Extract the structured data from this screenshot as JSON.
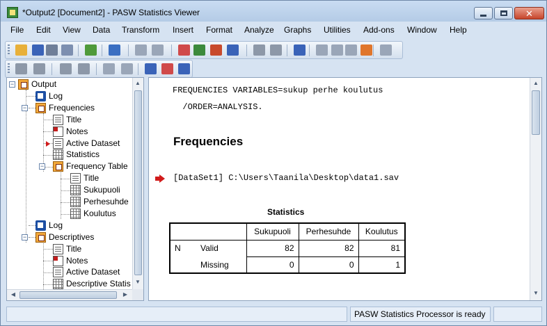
{
  "window": {
    "title": "*Output2 [Document2] - PASW Statistics Viewer",
    "min_glyph": "",
    "close_glyph": "✕"
  },
  "menu": [
    {
      "label": "File"
    },
    {
      "label": "Edit"
    },
    {
      "label": "View"
    },
    {
      "label": "Data"
    },
    {
      "label": "Transform"
    },
    {
      "label": "Insert"
    },
    {
      "label": "Format"
    },
    {
      "label": "Analyze"
    },
    {
      "label": "Graphs"
    },
    {
      "label": "Utilities"
    },
    {
      "label": "Add-ons"
    },
    {
      "label": "Window"
    },
    {
      "label": "Help"
    }
  ],
  "toolbar_icons": [
    {
      "name": "open-icon",
      "color": "#e8b03a"
    },
    {
      "name": "save-icon",
      "color": "#3a63b8"
    },
    {
      "name": "print-icon",
      "color": "#6f7f99"
    },
    {
      "name": "print-preview-icon",
      "color": "#7d8fb0"
    },
    {
      "name": "export-icon",
      "color": "#4f9a3a"
    },
    {
      "name": "recall-dialog-icon",
      "color": "#3b6fc2"
    },
    {
      "name": "undo-icon",
      "color": "#9aa6b8"
    },
    {
      "name": "redo-icon",
      "color": "#9aa6b8"
    },
    {
      "name": "goto-data-icon",
      "color": "#d04a4a"
    },
    {
      "name": "goto-case-icon",
      "color": "#3c8a3c"
    },
    {
      "name": "goto-variable-icon",
      "color": "#c84a2c"
    },
    {
      "name": "variables-icon",
      "color": "#3a63b8"
    },
    {
      "name": "use-sets-icon",
      "color": "#8d98a8"
    },
    {
      "name": "show-all-icon",
      "color": "#8d98a8"
    },
    {
      "name": "spell-check-icon",
      "color": "#3a63b8"
    },
    {
      "name": "promote-icon",
      "color": "#9aa6b8"
    },
    {
      "name": "demote-icon",
      "color": "#9aa6b8"
    },
    {
      "name": "designate-window-icon",
      "color": "#9aa6b8"
    },
    {
      "name": "run-script-icon",
      "color": "#e0762c"
    },
    {
      "name": "hide-icon",
      "color": "#9aa6b8"
    }
  ],
  "toolbar2_icons": [
    {
      "name": "back-arrow-icon",
      "color": "#8d98a8"
    },
    {
      "name": "forward-arrow-icon",
      "color": "#8d98a8"
    },
    {
      "name": "expand-icon",
      "color": "#8d98a8"
    },
    {
      "name": "collapse-icon",
      "color": "#8d98a8"
    },
    {
      "name": "show-icon",
      "color": "#9aa6b8"
    },
    {
      "name": "hide-item-icon",
      "color": "#9aa6b8"
    },
    {
      "name": "insert-heading-icon",
      "color": "#3a63b8"
    },
    {
      "name": "insert-title-icon",
      "color": "#d04a4a"
    },
    {
      "name": "insert-text-icon",
      "color": "#3a63b8"
    }
  ],
  "tree": {
    "root": "Output",
    "nodes": [
      {
        "label": "Log"
      },
      {
        "label": "Frequencies"
      },
      {
        "label": "Title"
      },
      {
        "label": "Notes"
      },
      {
        "label": "Active Dataset"
      },
      {
        "label": "Statistics"
      },
      {
        "label": "Frequency Table"
      },
      {
        "label": "Title"
      },
      {
        "label": "Sukupuoli"
      },
      {
        "label": "Perhesuhde"
      },
      {
        "label": "Koulutus"
      },
      {
        "label": "Log"
      },
      {
        "label": "Descriptives"
      },
      {
        "label": "Title"
      },
      {
        "label": "Notes"
      },
      {
        "label": "Active Dataset"
      },
      {
        "label": "Descriptive Statis"
      }
    ],
    "expander_minus": "−"
  },
  "content": {
    "syntax_line1": "FREQUENCIES VARIABLES=sukup perhe koulutus",
    "syntax_line2": "  /ORDER=ANALYSIS.",
    "heading": "Frequencies",
    "dataset_line": "[DataSet1] C:\\Users\\Taanila\\Desktop\\data1.sav",
    "table": {
      "title": "Statistics",
      "headers": [
        "Sukupuoli",
        "Perhesuhde",
        "Koulutus"
      ],
      "row_group": "N",
      "rows": [
        {
          "label": "Valid",
          "values": [
            "82",
            "82",
            "81"
          ]
        },
        {
          "label": "Missing",
          "values": [
            "0",
            "0",
            "1"
          ]
        }
      ]
    }
  },
  "status": {
    "processor": "PASW Statistics Processor is ready"
  }
}
